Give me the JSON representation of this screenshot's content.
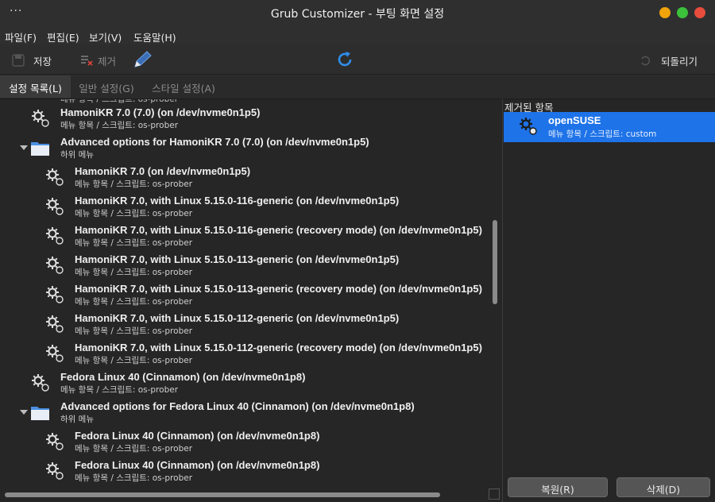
{
  "window": {
    "title": "Grub Customizer - 부팅 화면 설정",
    "menu_dots": "···",
    "controls": [
      {
        "name": "minimize",
        "color": "#f0a30a"
      },
      {
        "name": "maximize",
        "color": "#3cc13b"
      },
      {
        "name": "close",
        "color": "#e74c3c"
      }
    ]
  },
  "menubar": {
    "items": [
      "파일(F)",
      "편집(E)",
      "보기(V)",
      "도움말(H)"
    ]
  },
  "toolbar": {
    "save_label": "저장",
    "remove_label": "제거",
    "revert_label": "되돌리기",
    "icons": [
      "save-icon",
      "remove-icon",
      "edit-pencil-icon",
      "refresh-icon",
      "revert-icon"
    ],
    "accent": "#2f8ee8"
  },
  "tabs": [
    {
      "label": "설정 목록(L)",
      "active": true
    },
    {
      "label": "일반 설정(G)",
      "active": false
    },
    {
      "label": "스타일 설정(A)",
      "active": false
    }
  ],
  "entries": {
    "top_partial_desc": "메뉴 항목 / 스크립트: os-prober",
    "items": [
      {
        "name": "HamoniKR 7.0 (7.0) (on /dev/nvme0n1p5)",
        "desc": "메뉴 항목 / 스크립트: os-prober",
        "type": "entry"
      },
      {
        "name": "Advanced options for HamoniKR 7.0 (7.0) (on /dev/nvme0n1p5)",
        "desc": "하위 메뉴",
        "type": "submenu"
      },
      {
        "name": "HamoniKR 7.0 (on /dev/nvme0n1p5)",
        "desc": "메뉴 항목 / 스크립트: os-prober",
        "type": "child"
      },
      {
        "name": "HamoniKR 7.0, with Linux 5.15.0-116-generic (on /dev/nvme0n1p5)",
        "desc": "메뉴 항목 / 스크립트: os-prober",
        "type": "child"
      },
      {
        "name": "HamoniKR 7.0, with Linux 5.15.0-116-generic (recovery mode) (on /dev/nvme0n1p5)",
        "desc": "메뉴 항목 / 스크립트: os-prober",
        "type": "child"
      },
      {
        "name": "HamoniKR 7.0, with Linux 5.15.0-113-generic (on /dev/nvme0n1p5)",
        "desc": "메뉴 항목 / 스크립트: os-prober",
        "type": "child"
      },
      {
        "name": "HamoniKR 7.0, with Linux 5.15.0-113-generic (recovery mode) (on /dev/nvme0n1p5)",
        "desc": "메뉴 항목 / 스크립트: os-prober",
        "type": "child"
      },
      {
        "name": "HamoniKR 7.0, with Linux 5.15.0-112-generic (on /dev/nvme0n1p5)",
        "desc": "메뉴 항목 / 스크립트: os-prober",
        "type": "child"
      },
      {
        "name": "HamoniKR 7.0, with Linux 5.15.0-112-generic (recovery mode) (on /dev/nvme0n1p5)",
        "desc": "메뉴 항목 / 스크립트: os-prober",
        "type": "child"
      },
      {
        "name": "Fedora Linux 40 (Cinnamon) (on /dev/nvme0n1p8)",
        "desc": "메뉴 항목 / 스크립트: os-prober",
        "type": "entry"
      },
      {
        "name": "Advanced options for Fedora Linux 40 (Cinnamon) (on /dev/nvme0n1p8)",
        "desc": "하위 메뉴",
        "type": "submenu"
      },
      {
        "name": "Fedora Linux 40 (Cinnamon) (on /dev/nvme0n1p8)",
        "desc": "메뉴 항목 / 스크립트: os-prober",
        "type": "child"
      },
      {
        "name": "Fedora Linux 40 (Cinnamon) (on /dev/nvme0n1p8)",
        "desc": "메뉴 항목 / 스크립트: os-prober",
        "type": "child"
      }
    ]
  },
  "removed": {
    "label": "제거된 항목",
    "items": [
      {
        "name": "openSUSE",
        "desc": "메뉴 항목 / 스크립트: custom"
      }
    ],
    "restore_label": "복원(R)",
    "delete_label": "삭제(D)",
    "selection_color": "#1e73e8"
  }
}
